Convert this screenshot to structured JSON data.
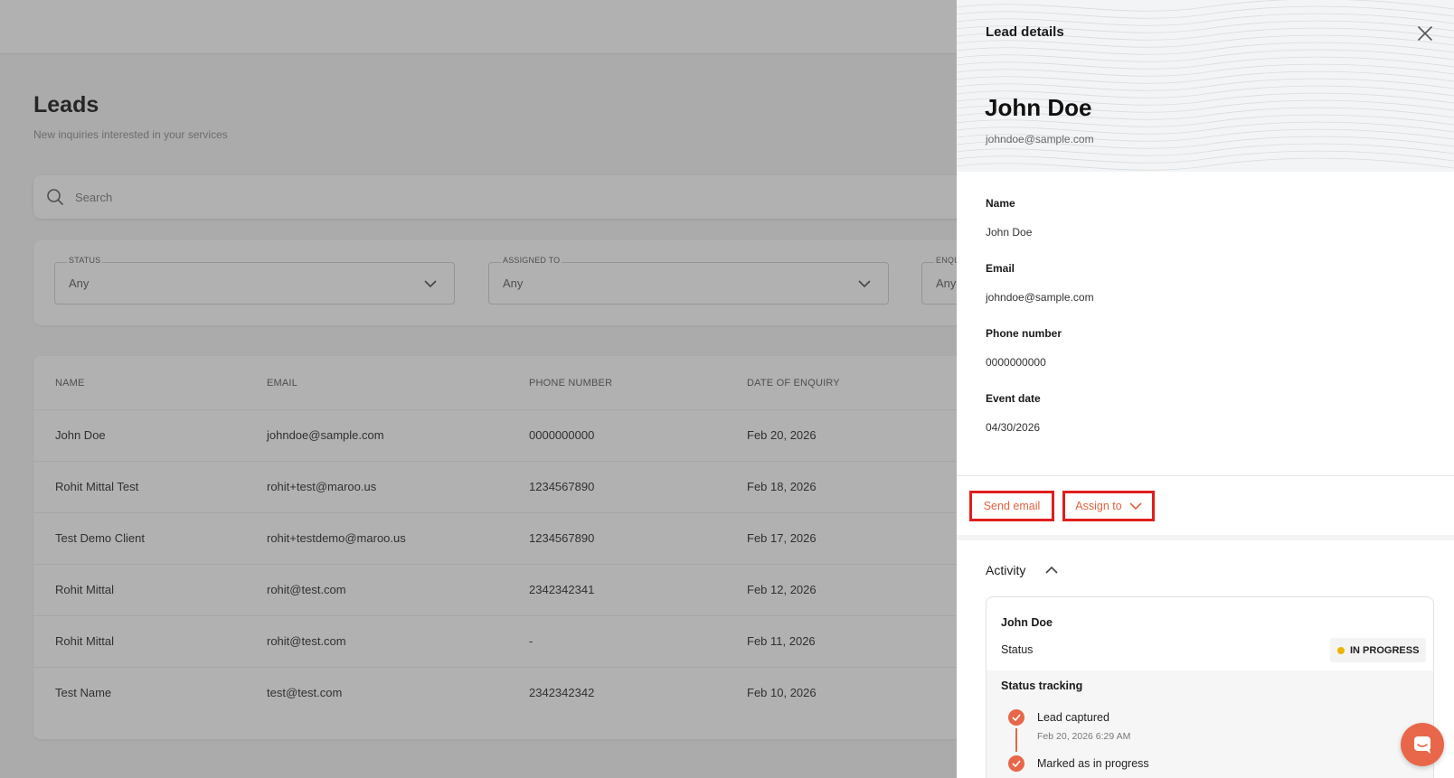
{
  "page": {
    "title": "Leads",
    "subtitle": "New inquiries interested in your services"
  },
  "search": {
    "placeholder": "Search"
  },
  "filters": [
    {
      "label": "STATUS",
      "value": "Any"
    },
    {
      "label": "ASSIGNED TO",
      "value": "Any"
    },
    {
      "label": "ENQU",
      "value": "Any"
    }
  ],
  "table": {
    "columns": [
      "NAME",
      "EMAIL",
      "PHONE NUMBER",
      "DATE OF ENQUIRY"
    ],
    "rows": [
      [
        "John Doe",
        "johndoe@sample.com",
        "0000000000",
        "Feb 20, 2026"
      ],
      [
        "Rohit Mittal Test",
        "rohit+test@maroo.us",
        "1234567890",
        "Feb 18, 2026"
      ],
      [
        "Test Demo Client",
        "rohit+testdemo@maroo.us",
        "1234567890",
        "Feb 17, 2026"
      ],
      [
        "Rohit Mittal",
        "rohit@test.com",
        "2342342341",
        "Feb 12, 2026"
      ],
      [
        "Rohit Mittal",
        "rohit@test.com",
        "-",
        "Feb 11, 2026"
      ],
      [
        "Test Name",
        "test@test.com",
        "2342342342",
        "Feb 10, 2026"
      ]
    ]
  },
  "drawer": {
    "title": "Lead details",
    "lead_name": "John Doe",
    "lead_email": "johndoe@sample.com",
    "fields": [
      {
        "label": "Name",
        "value": "John Doe"
      },
      {
        "label": "Email",
        "value": "johndoe@sample.com"
      },
      {
        "label": "Phone number",
        "value": "0000000000"
      },
      {
        "label": "Event date",
        "value": "04/30/2026"
      }
    ],
    "actions": {
      "send_email": "Send email",
      "assign_to": "Assign to"
    },
    "activity": {
      "title": "Activity",
      "card_name": "John Doe",
      "status_label": "Status",
      "status_value": "IN PROGRESS",
      "tracking_title": "Status tracking",
      "steps": [
        {
          "text": "Lead captured",
          "time": "Feb 20, 2026 6:29 AM"
        },
        {
          "text": "Marked as in progress",
          "time": ""
        }
      ]
    }
  },
  "colors": {
    "accent": "#e8674a",
    "status_in_progress": "#f0b400",
    "highlight_border": "#e01e1e"
  },
  "icons": [
    "search-icon",
    "chevron-down-icon",
    "close-icon",
    "chevron-up-icon",
    "check-icon",
    "chat-icon"
  ]
}
